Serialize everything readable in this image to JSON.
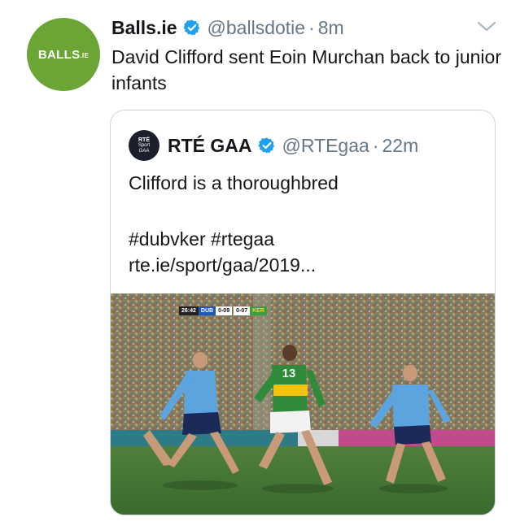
{
  "tweet": {
    "avatar_text": "BALLS",
    "avatar_suffix": ".IE",
    "name": "Balls.ie",
    "handle": "@ballsdotie",
    "separator": "·",
    "time": "8m",
    "text": "David Clifford sent Eoin Murchan back to junior infants"
  },
  "quoted": {
    "avatar_line1": "RTÉ",
    "avatar_line2": "Sport",
    "avatar_line3": "GAA",
    "name": "RTÉ GAA",
    "handle": "@RTEgaa",
    "separator": "·",
    "time": "22m",
    "text_line1": "Clifford is a thoroughbred",
    "hashtags": "#dubvker #rtegaa",
    "link": "rte.ie/sport/gaa/2019..."
  },
  "media": {
    "clock": "26:42",
    "team1": "DUB",
    "score1": "0-09",
    "score2": "0-07",
    "team2": "KER",
    "jersey_number": "13"
  },
  "colors": {
    "verified": "#1da1f2",
    "avatar_bg": "#6aa536",
    "secondary_text": "#657786",
    "border": "#ccd6dd"
  },
  "icons": {
    "verified": "verified-badge-icon",
    "caret": "chevron-down-icon"
  }
}
